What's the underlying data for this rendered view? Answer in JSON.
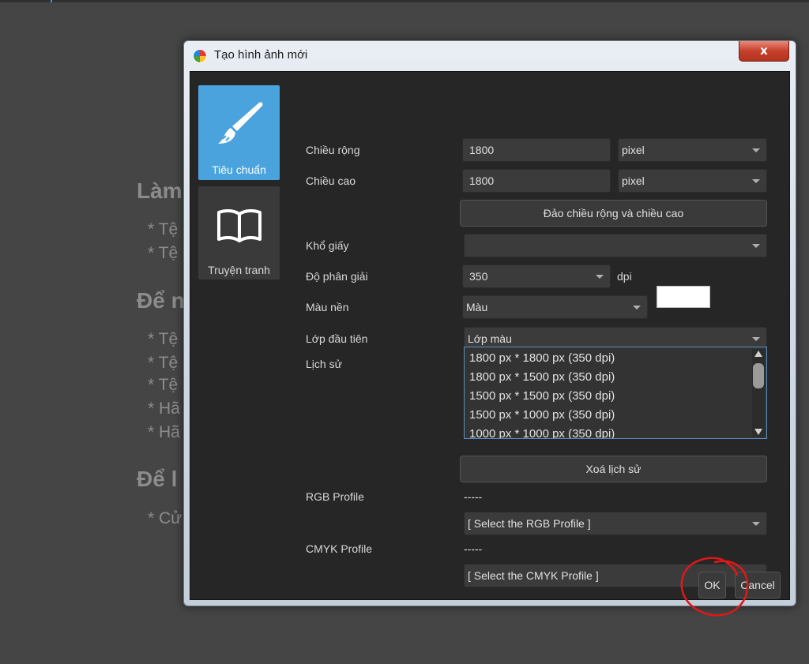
{
  "background_doc": {
    "headings": [
      "Làm",
      "Để n",
      "Để l"
    ],
    "items": [
      "* Tệ",
      "* Tệ",
      "* Tệ",
      "* Tệ",
      "* Tệ",
      "* Hã",
      "* Hã",
      "* Cử"
    ]
  },
  "dialog": {
    "title": "Tạo hình ảnh mới",
    "close_label": "x",
    "sidebar": {
      "items": [
        {
          "label": "Tiêu chuẩn",
          "icon": "brush-icon",
          "selected": true
        },
        {
          "label": "Truyện tranh",
          "icon": "book-icon",
          "selected": false
        }
      ]
    },
    "form": {
      "width": {
        "label": "Chiều rộng",
        "value": "1800",
        "unit": "pixel"
      },
      "height": {
        "label": "Chiều cao",
        "value": "1800",
        "unit": "pixel"
      },
      "swap_button": "Đảo chiều rộng và chiều cao",
      "paper": {
        "label": "Khổ giấy",
        "value": ""
      },
      "resolution": {
        "label": "Độ phân giải",
        "value": "350",
        "unit": "dpi"
      },
      "background": {
        "label": "Màu nền",
        "value": "Màu",
        "swatch_color": "#ffffff"
      },
      "first_layer": {
        "label": "Lớp đầu tiên",
        "value": "Lớp màu"
      },
      "history": {
        "label": "Lịch sử",
        "items": [
          "1800 px * 1800 px (350 dpi)",
          "1800 px * 1500 px (350 dpi)",
          "1500 px * 1500 px (350 dpi)",
          "1500 px * 1000 px (350 dpi)",
          "1000 px * 1000 px (350 dpi)"
        ]
      },
      "clear_history_button": "Xoá lịch sử",
      "rgb_profile": {
        "label": "RGB Profile",
        "current": "-----",
        "select": "[ Select the RGB Profile ]"
      },
      "cmyk_profile": {
        "label": "CMYK Profile",
        "current": "-----",
        "select": "[ Select the CMYK Profile ]"
      }
    },
    "ok_button": "OK",
    "cancel_button": "Cancel"
  },
  "colors": {
    "accent": "#4aa3dd",
    "annotation": "#e01818",
    "dialog_bg": "#262626"
  }
}
